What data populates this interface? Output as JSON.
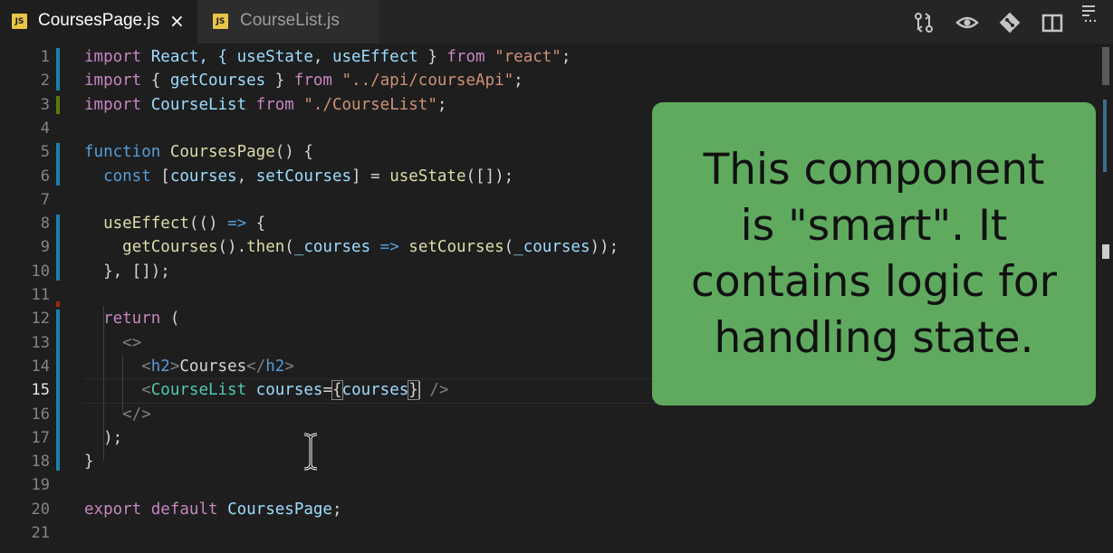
{
  "tabs": [
    {
      "label": "CoursesPage.js",
      "badge": "JS",
      "active": true,
      "close": "×"
    },
    {
      "label": "CourseList.js",
      "badge": "JS",
      "active": false
    }
  ],
  "toolbar": {
    "icons": [
      "compare-changes-icon",
      "preview-icon",
      "git-icon",
      "split-editor-icon",
      "more-actions-icon"
    ]
  },
  "editor": {
    "current_line": 15,
    "line_numbers": [
      "1",
      "2",
      "3",
      "4",
      "5",
      "6",
      "7",
      "8",
      "9",
      "10",
      "11",
      "12",
      "13",
      "14",
      "15",
      "16",
      "17",
      "18",
      "19",
      "20",
      "21"
    ],
    "lines": [
      [
        {
          "t": "import",
          "c": "kw2"
        },
        {
          "t": " React, { ",
          "c": "id"
        },
        {
          "t": "useState",
          "c": "id"
        },
        {
          "t": ", ",
          "c": "pun"
        },
        {
          "t": "useEffect",
          "c": "id"
        },
        {
          "t": " } ",
          "c": "pun"
        },
        {
          "t": "from",
          "c": "kw2"
        },
        {
          "t": " ",
          "c": "pun"
        },
        {
          "t": "\"react\"",
          "c": "str"
        },
        {
          "t": ";",
          "c": "pun"
        }
      ],
      [
        {
          "t": "import",
          "c": "kw2"
        },
        {
          "t": " { ",
          "c": "pun"
        },
        {
          "t": "getCourses",
          "c": "id"
        },
        {
          "t": " } ",
          "c": "pun"
        },
        {
          "t": "from",
          "c": "kw2"
        },
        {
          "t": " ",
          "c": "pun"
        },
        {
          "t": "\"../api/courseApi\"",
          "c": "str"
        },
        {
          "t": ";",
          "c": "pun"
        }
      ],
      [
        {
          "t": "import",
          "c": "kw2"
        },
        {
          "t": " ",
          "c": "pun"
        },
        {
          "t": "CourseList",
          "c": "id"
        },
        {
          "t": " ",
          "c": "pun"
        },
        {
          "t": "from",
          "c": "kw2"
        },
        {
          "t": " ",
          "c": "pun"
        },
        {
          "t": "\"./CourseList\"",
          "c": "str"
        },
        {
          "t": ";",
          "c": "pun"
        }
      ],
      [],
      [
        {
          "t": "function",
          "c": "kw"
        },
        {
          "t": " ",
          "c": "pun"
        },
        {
          "t": "CoursesPage",
          "c": "fn"
        },
        {
          "t": "() {",
          "c": "pun"
        }
      ],
      [
        {
          "t": "  ",
          "c": "pun"
        },
        {
          "t": "const",
          "c": "kw"
        },
        {
          "t": " [",
          "c": "pun"
        },
        {
          "t": "courses",
          "c": "id"
        },
        {
          "t": ", ",
          "c": "pun"
        },
        {
          "t": "setCourses",
          "c": "id"
        },
        {
          "t": "] = ",
          "c": "pun"
        },
        {
          "t": "useState",
          "c": "fn"
        },
        {
          "t": "([]);",
          "c": "pun"
        }
      ],
      [],
      [
        {
          "t": "  ",
          "c": "pun"
        },
        {
          "t": "useEffect",
          "c": "fn"
        },
        {
          "t": "(() ",
          "c": "pun"
        },
        {
          "t": "=>",
          "c": "kw"
        },
        {
          "t": " {",
          "c": "pun"
        }
      ],
      [
        {
          "t": "    ",
          "c": "pun"
        },
        {
          "t": "getCourses",
          "c": "fn"
        },
        {
          "t": "().",
          "c": "pun"
        },
        {
          "t": "then",
          "c": "fn"
        },
        {
          "t": "(",
          "c": "pun"
        },
        {
          "t": "_courses",
          "c": "id"
        },
        {
          "t": " ",
          "c": "pun"
        },
        {
          "t": "=>",
          "c": "kw"
        },
        {
          "t": " ",
          "c": "pun"
        },
        {
          "t": "setCourses",
          "c": "fn"
        },
        {
          "t": "(",
          "c": "pun"
        },
        {
          "t": "_courses",
          "c": "id"
        },
        {
          "t": "));",
          "c": "pun"
        }
      ],
      [
        {
          "t": "  }, []);",
          "c": "pun"
        }
      ],
      [],
      [
        {
          "t": "  ",
          "c": "pun"
        },
        {
          "t": "return",
          "c": "kw2"
        },
        {
          "t": " (",
          "c": "pun"
        }
      ],
      [
        {
          "t": "    ",
          "c": "pun"
        },
        {
          "t": "<>",
          "c": "tag"
        }
      ],
      [
        {
          "t": "      ",
          "c": "pun"
        },
        {
          "t": "<",
          "c": "tag"
        },
        {
          "t": "h2",
          "c": "tagname"
        },
        {
          "t": ">",
          "c": "tag"
        },
        {
          "t": "Courses",
          "c": "jsxtext"
        },
        {
          "t": "</",
          "c": "tag"
        },
        {
          "t": "h2",
          "c": "tagname"
        },
        {
          "t": ">",
          "c": "tag"
        }
      ],
      [
        {
          "t": "      ",
          "c": "pun"
        },
        {
          "t": "<",
          "c": "tag"
        },
        {
          "t": "CourseList",
          "c": "cls"
        },
        {
          "t": " ",
          "c": "pun"
        },
        {
          "t": "courses",
          "c": "id"
        },
        {
          "t": "=",
          "c": "pun"
        },
        {
          "t": "{",
          "c": "pun",
          "box": true
        },
        {
          "t": "courses",
          "c": "id"
        },
        {
          "t": "}",
          "c": "pun",
          "box": true,
          "caret": true
        },
        {
          "t": " ",
          "c": "pun"
        },
        {
          "t": "/>",
          "c": "tag"
        }
      ],
      [
        {
          "t": "    ",
          "c": "pun"
        },
        {
          "t": "</>",
          "c": "tag"
        }
      ],
      [
        {
          "t": "  );",
          "c": "pun"
        }
      ],
      [
        {
          "t": "}",
          "c": "pun"
        }
      ],
      [],
      [
        {
          "t": "export",
          "c": "kw2"
        },
        {
          "t": " ",
          "c": "pun"
        },
        {
          "t": "default",
          "c": "kw2"
        },
        {
          "t": " ",
          "c": "pun"
        },
        {
          "t": "CoursesPage",
          "c": "id"
        },
        {
          "t": ";",
          "c": "pun"
        }
      ],
      []
    ]
  },
  "callout": {
    "lines": [
      "This component",
      "is \"smart\". It",
      "contains logic for",
      "handling state."
    ]
  },
  "colors": {
    "callout_bg": "#5faa5f",
    "editor_bg": "#1e1e1e",
    "change_modified": "#1b81a8",
    "change_added": "#587c0c",
    "change_deleted": "#a1260d"
  }
}
